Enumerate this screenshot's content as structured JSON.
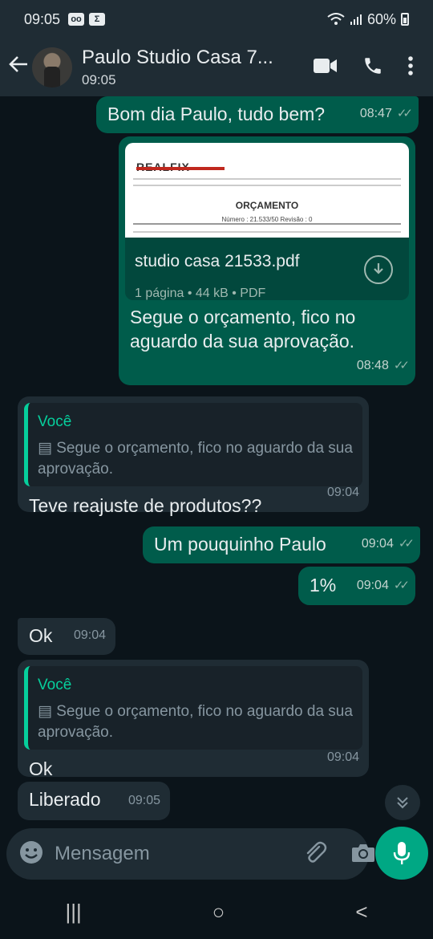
{
  "status_bar": {
    "time": "09:05",
    "battery": "60%"
  },
  "header": {
    "contact_name": "Paulo Studio Casa 7...",
    "subtitle": "09:05"
  },
  "messages": [
    {
      "type": "out",
      "text": "Bom dia Paulo, tudo bem?",
      "time": "08:47"
    },
    {
      "type": "out_document",
      "doc": {
        "thumb_logo": "REALFIX",
        "thumb_heading": "ORÇAMENTO",
        "thumb_sub": "Número : 21.533/50     Revisão : 0",
        "name": "studio casa 21533.pdf",
        "details": "1 página • 44 kB • PDF"
      },
      "caption": "Segue o orçamento, fico no aguardo da sua aprovação.",
      "time": "08:48"
    },
    {
      "type": "in_reply",
      "quote_author": "Você",
      "quote_text": "Segue o orçamento, fico no aguardo da sua aprovação.",
      "text": "Teve reajuste de produtos??",
      "time": "09:04"
    },
    {
      "type": "out",
      "text": "Um pouquinho Paulo",
      "time": "09:04"
    },
    {
      "type": "out",
      "text": "1%",
      "time": "09:04"
    },
    {
      "type": "in",
      "text": "Ok",
      "time": "09:04"
    },
    {
      "type": "in_reply",
      "quote_author": "Você",
      "quote_text": "Segue o orçamento, fico no aguardo da sua aprovação.",
      "text": "Ok",
      "time": "09:04"
    },
    {
      "type": "in",
      "text": "Liberado",
      "time": "09:05"
    }
  ],
  "composer": {
    "placeholder": "Mensagem"
  },
  "nav_bar": {
    "recents": "|||",
    "home": "○",
    "back": "<"
  },
  "colors": {
    "outgoing": "#005c4b",
    "incoming": "#1f2c34",
    "accent": "#00a884",
    "quote_accent": "#06cf9c"
  },
  "icons": [
    "back-arrow-icon",
    "video-call-icon",
    "phone-icon",
    "more-options-icon",
    "download-icon",
    "document-icon",
    "emoji-icon",
    "attach-icon",
    "camera-icon",
    "mic-icon",
    "scroll-down-icon"
  ]
}
